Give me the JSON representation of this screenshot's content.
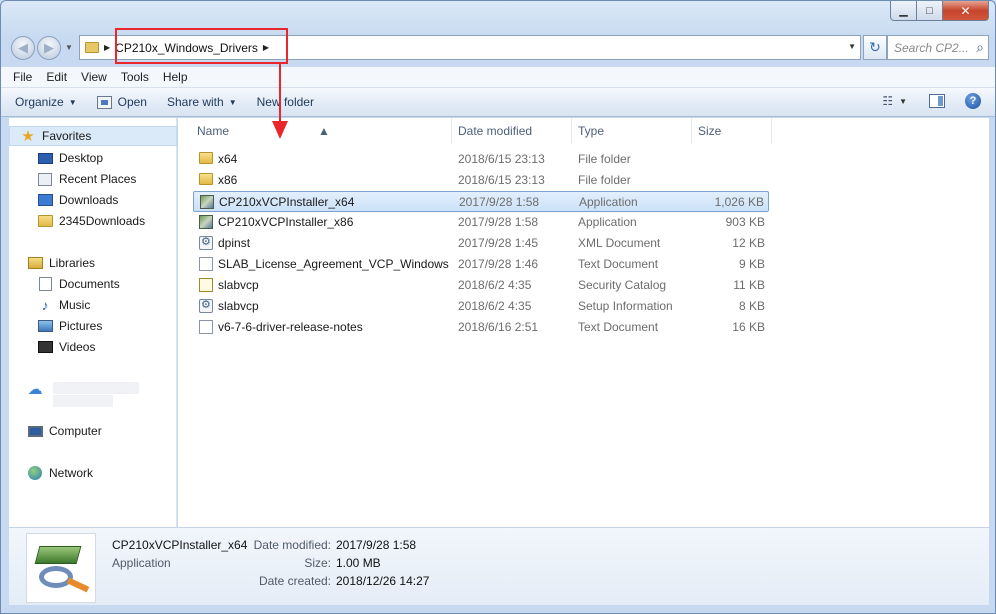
{
  "window": {
    "caption": {
      "minimize": "▁",
      "maximize": "□",
      "close": "✕"
    }
  },
  "navbar": {
    "back_glyph": "◀",
    "forward_glyph": "▶",
    "breadcrumb": [
      "CP210x_Windows_Drivers"
    ],
    "refresh_glyph": "↻",
    "search_placeholder": "Search CP2..."
  },
  "menubar": [
    "File",
    "Edit",
    "View",
    "Tools",
    "Help"
  ],
  "toolbar": {
    "organize": "Organize",
    "open": "Open",
    "share_with": "Share with",
    "new_folder": "New folder",
    "help": "?"
  },
  "navpane": {
    "favorites": {
      "label": "Favorites",
      "items": [
        "Desktop",
        "Recent Places",
        "Downloads",
        "2345Downloads"
      ]
    },
    "libraries": {
      "label": "Libraries",
      "items": [
        "Documents",
        "Music",
        "Pictures",
        "Videos"
      ]
    },
    "computer": "Computer",
    "network": "Network"
  },
  "filelist": {
    "columns": [
      "Name",
      "Date modified",
      "Type",
      "Size"
    ],
    "rows": [
      {
        "icon": "folder-icon",
        "name": "x64",
        "date": "2018/6/15 23:13",
        "type": "File folder",
        "size": ""
      },
      {
        "icon": "folder-icon",
        "name": "x86",
        "date": "2018/6/15 23:13",
        "type": "File folder",
        "size": ""
      },
      {
        "icon": "installer-icon",
        "name": "CP210xVCPInstaller_x64",
        "date": "2017/9/28 1:58",
        "type": "Application",
        "size": "1,026 KB",
        "selected": true
      },
      {
        "icon": "installer-icon",
        "name": "CP210xVCPInstaller_x86",
        "date": "2017/9/28 1:58",
        "type": "Application",
        "size": "903 KB"
      },
      {
        "icon": "config-file-icon",
        "name": "dpinst",
        "date": "2017/9/28 1:45",
        "type": "XML Document",
        "size": "12 KB"
      },
      {
        "icon": "text-file-icon",
        "name": "SLAB_License_Agreement_VCP_Windows",
        "date": "2017/9/28 1:46",
        "type": "Text Document",
        "size": "9 KB"
      },
      {
        "icon": "security-catalog-icon",
        "name": "slabvcp",
        "date": "2018/6/2 4:35",
        "type": "Security Catalog",
        "size": "11 KB"
      },
      {
        "icon": "config-file-icon",
        "name": "slabvcp",
        "date": "2018/6/2 4:35",
        "type": "Setup Information",
        "size": "8 KB"
      },
      {
        "icon": "text-file-icon",
        "name": "v6-7-6-driver-release-notes",
        "date": "2018/6/16 2:51",
        "type": "Text Document",
        "size": "16 KB"
      }
    ]
  },
  "details": {
    "name": "CP210xVCPInstaller_x64",
    "type": "Application",
    "date_modified_label": "Date modified:",
    "date_modified": "2017/9/28 1:58",
    "size_label": "Size:",
    "size": "1.00 MB",
    "date_created_label": "Date created:",
    "date_created": "2018/12/26 14:27"
  },
  "colors": {
    "annotation_red": "#e8262c",
    "selection_blue": "#cce1f8"
  }
}
